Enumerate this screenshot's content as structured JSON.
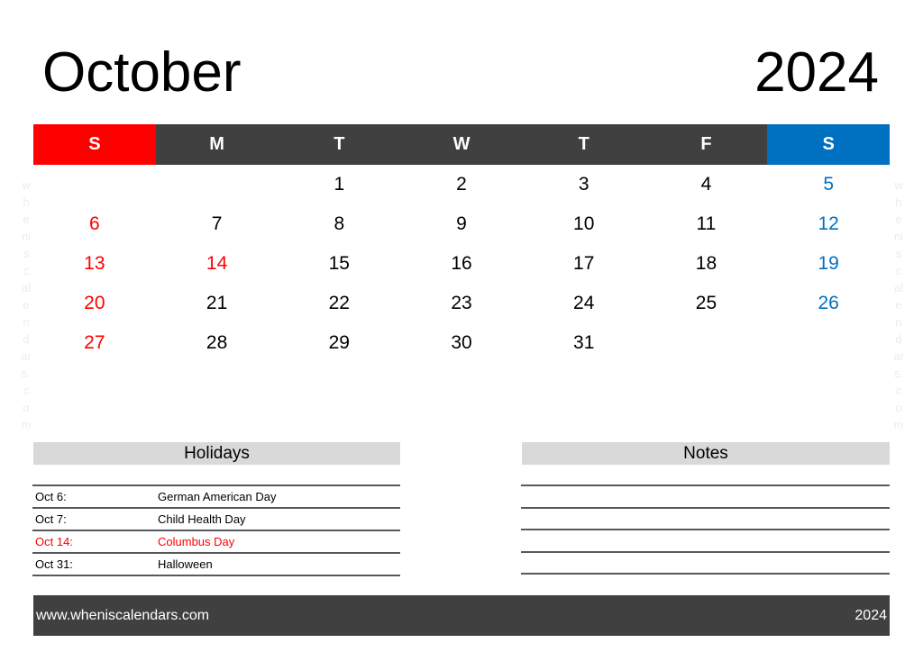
{
  "header": {
    "month": "October",
    "year": "2024"
  },
  "weekdays": [
    {
      "label": "S",
      "type": "sun"
    },
    {
      "label": "M",
      "type": ""
    },
    {
      "label": "T",
      "type": ""
    },
    {
      "label": "W",
      "type": ""
    },
    {
      "label": "T",
      "type": ""
    },
    {
      "label": "F",
      "type": ""
    },
    {
      "label": "S",
      "type": "sat"
    }
  ],
  "weeks": [
    [
      "",
      "",
      "1",
      "2",
      "3",
      "4",
      "5"
    ],
    [
      "6",
      "7",
      "8",
      "9",
      "10",
      "11",
      "12"
    ],
    [
      "13",
      "14",
      "15",
      "16",
      "17",
      "18",
      "19"
    ],
    [
      "20",
      "21",
      "22",
      "23",
      "24",
      "25",
      "26"
    ],
    [
      "27",
      "28",
      "29",
      "30",
      "31",
      "",
      ""
    ]
  ],
  "highlighted_holiday_dates": [
    "14"
  ],
  "colors": {
    "sunday": "#ff0000",
    "saturday": "#0070c0",
    "header_bg": "#404040",
    "holiday": "#ff0000"
  },
  "watermark": [
    "w",
    "h",
    "e",
    "ni",
    "s",
    "c",
    "al",
    "e",
    "n",
    "d",
    "ar",
    "s.",
    "c",
    "o",
    "m"
  ],
  "holidays": {
    "title": "Holidays",
    "items": [
      {
        "date": "Oct 6:",
        "name": "German American Day",
        "highlight": false
      },
      {
        "date": "Oct 7:",
        "name": "Child Health Day",
        "highlight": false
      },
      {
        "date": "Oct 14:",
        "name": "Columbus Day",
        "highlight": true
      },
      {
        "date": "Oct 31:",
        "name": "Halloween",
        "highlight": false
      }
    ]
  },
  "notes": {
    "title": "Notes",
    "line_count": 5
  },
  "footer": {
    "url": "www.wheniscalendars.com",
    "year": "2024"
  }
}
